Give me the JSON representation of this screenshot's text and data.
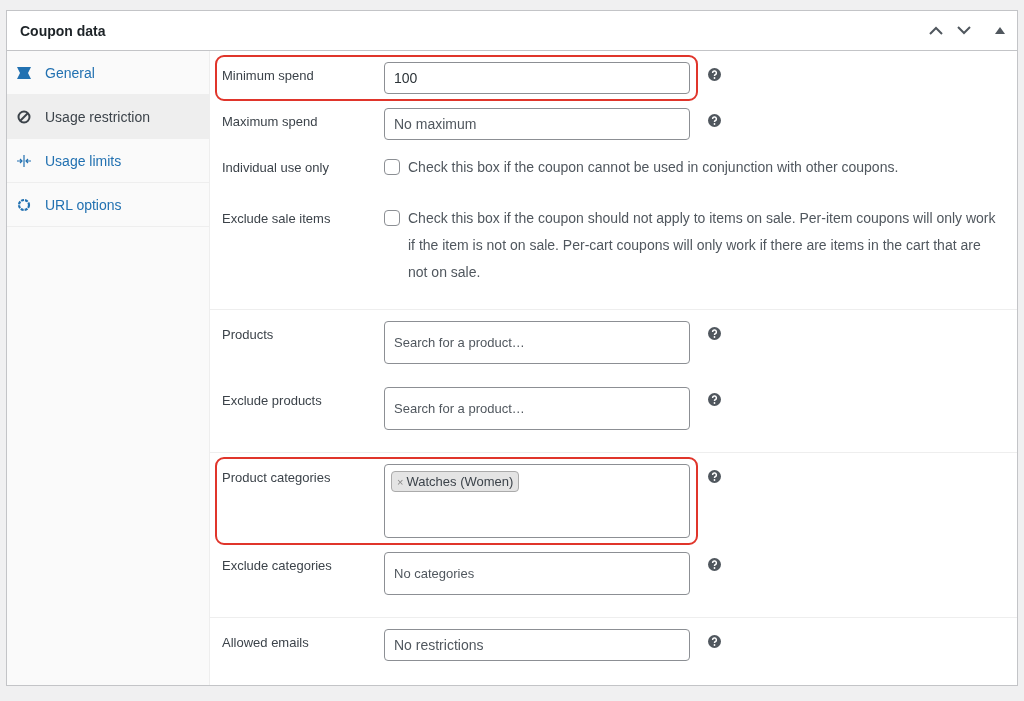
{
  "panel": {
    "title": "Coupon data"
  },
  "tabs": [
    {
      "label": "General",
      "selected": false
    },
    {
      "label": "Usage restriction",
      "selected": true
    },
    {
      "label": "Usage limits",
      "selected": false
    },
    {
      "label": "URL options",
      "selected": false
    }
  ],
  "groups": [
    {
      "fields": [
        {
          "kind": "text",
          "label": "Minimum spend",
          "value": "100",
          "highlighted": true,
          "help": true
        },
        {
          "kind": "text",
          "label": "Maximum spend",
          "placeholder": "No maximum",
          "highlighted": false,
          "help": true
        },
        {
          "kind": "checkbox",
          "label": "Individual use only",
          "checked": false,
          "description": "Check this box if the coupon cannot be used in conjunction with other coupons.",
          "highlighted": false,
          "help": false
        },
        {
          "kind": "checkbox",
          "label": "Exclude sale items",
          "checked": false,
          "description": "Check this box if the coupon should not apply to items on sale. Per-item coupons will only work if the item is not on sale. Per-cart coupons will only work if there are items in the cart that are not on sale.",
          "highlighted": false,
          "help": false
        }
      ]
    },
    {
      "fields": [
        {
          "kind": "select",
          "label": "Products",
          "placeholder": "Search for a product…",
          "highlighted": false,
          "help": true
        },
        {
          "kind": "select",
          "label": "Exclude products",
          "placeholder": "Search for a product…",
          "highlighted": false,
          "help": true
        }
      ]
    },
    {
      "fields": [
        {
          "kind": "tokens",
          "label": "Product categories",
          "tokens": [
            {
              "remove": "×",
              "label": "Watches (Women)"
            }
          ],
          "highlighted": true,
          "help": true
        },
        {
          "kind": "select",
          "label": "Exclude categories",
          "placeholder": "No categories",
          "highlighted": false,
          "help": true
        }
      ]
    },
    {
      "fields": [
        {
          "kind": "text",
          "label": "Allowed emails",
          "placeholder": "No restrictions",
          "highlighted": false,
          "help": true
        }
      ]
    }
  ]
}
